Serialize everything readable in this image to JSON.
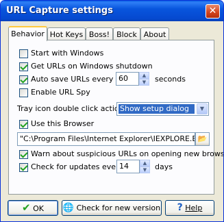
{
  "window": {
    "title": "URL Capture settings",
    "close_glyph": "✕"
  },
  "tabs": [
    {
      "label": "Behavior",
      "active": true
    },
    {
      "label": "Hot Keys",
      "active": false
    },
    {
      "label": "Boss!",
      "active": false
    },
    {
      "label": "Block",
      "active": false
    },
    {
      "label": "About",
      "active": false
    }
  ],
  "behavior": {
    "start_with_windows": {
      "label": "Start with Windows",
      "checked": false
    },
    "get_urls_on_shutdown": {
      "label": "Get URLs on Windows shutdown",
      "checked": true
    },
    "auto_save": {
      "label": "Auto save URLs every",
      "checked": true,
      "value": "60",
      "unit": "seconds"
    },
    "enable_url_spy": {
      "label": "Enable URL Spy",
      "checked": false
    },
    "tray_action": {
      "label": "Tray icon double click action",
      "value": "Show setup dialog"
    },
    "use_browser": {
      "label": "Use this Browser",
      "checked": true
    },
    "browser_path": "\"C:\\Program Files\\Internet Explorer\\IEXPLORE.EXE\"",
    "warn_suspicious": {
      "label": "Warn about suspicious URLs on opening new browser",
      "checked": true
    },
    "check_updates": {
      "label": "Check for updates every",
      "checked": true,
      "value": "14",
      "unit": "days"
    }
  },
  "buttons": {
    "ok": "OK",
    "check_version": "Check for new version",
    "help": "Help"
  },
  "icons": {
    "ok": "checkmark-icon",
    "check_version": "globe-icon",
    "help": "question-mark-icon",
    "browse": "folder-open-icon"
  },
  "colors": {
    "titlebar": "#0855dd",
    "selection": "#316ac5",
    "check": "#21a121",
    "active_tab_accent": "#ffc83c"
  }
}
